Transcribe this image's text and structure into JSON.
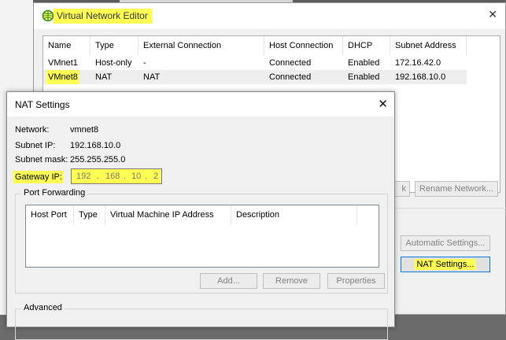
{
  "main_window": {
    "title": "Virtual Network Editor",
    "columns": [
      "Name",
      "Type",
      "External Connection",
      "Host Connection",
      "DHCP",
      "Subnet Address"
    ],
    "rows": [
      {
        "name": "VMnet1",
        "type": "Host-only",
        "external": "-",
        "host": "Connected",
        "dhcp": "Enabled",
        "subnet": "172.16.42.0"
      },
      {
        "name": "VMnet8",
        "type": "NAT",
        "external": "NAT",
        "host": "Connected",
        "dhcp": "Enabled",
        "subnet": "192.168.10.0"
      }
    ],
    "buttons": {
      "partial": "k",
      "rename": "Rename Network...",
      "automatic": "Automatic Settings...",
      "nat_settings": "NAT Settings..."
    }
  },
  "nat_dialog": {
    "title": "NAT Settings",
    "network_label": "Network:",
    "network_value": "vmnet8",
    "subnet_ip_label": "Subnet IP:",
    "subnet_ip_value": "192.168.10.0",
    "subnet_mask_label": "Subnet mask:",
    "subnet_mask_value": "255.255.255.0",
    "gateway_label": "Gateway IP:",
    "gateway_octets": [
      "192",
      "168",
      "10",
      "2"
    ],
    "gateway_dot": ".",
    "port_forwarding": {
      "legend": "Port Forwarding",
      "columns": [
        "Host Port",
        "Type",
        "Virtual Machine IP Address",
        "Description"
      ],
      "buttons": {
        "add": "Add...",
        "remove": "Remove",
        "properties": "Properties"
      }
    },
    "advanced_legend": "Advanced"
  },
  "colors": {
    "highlight": "#ffff55",
    "focus_border": "#0078d7"
  },
  "icons": {
    "app": "network-globe-icon",
    "close": "close-icon"
  }
}
